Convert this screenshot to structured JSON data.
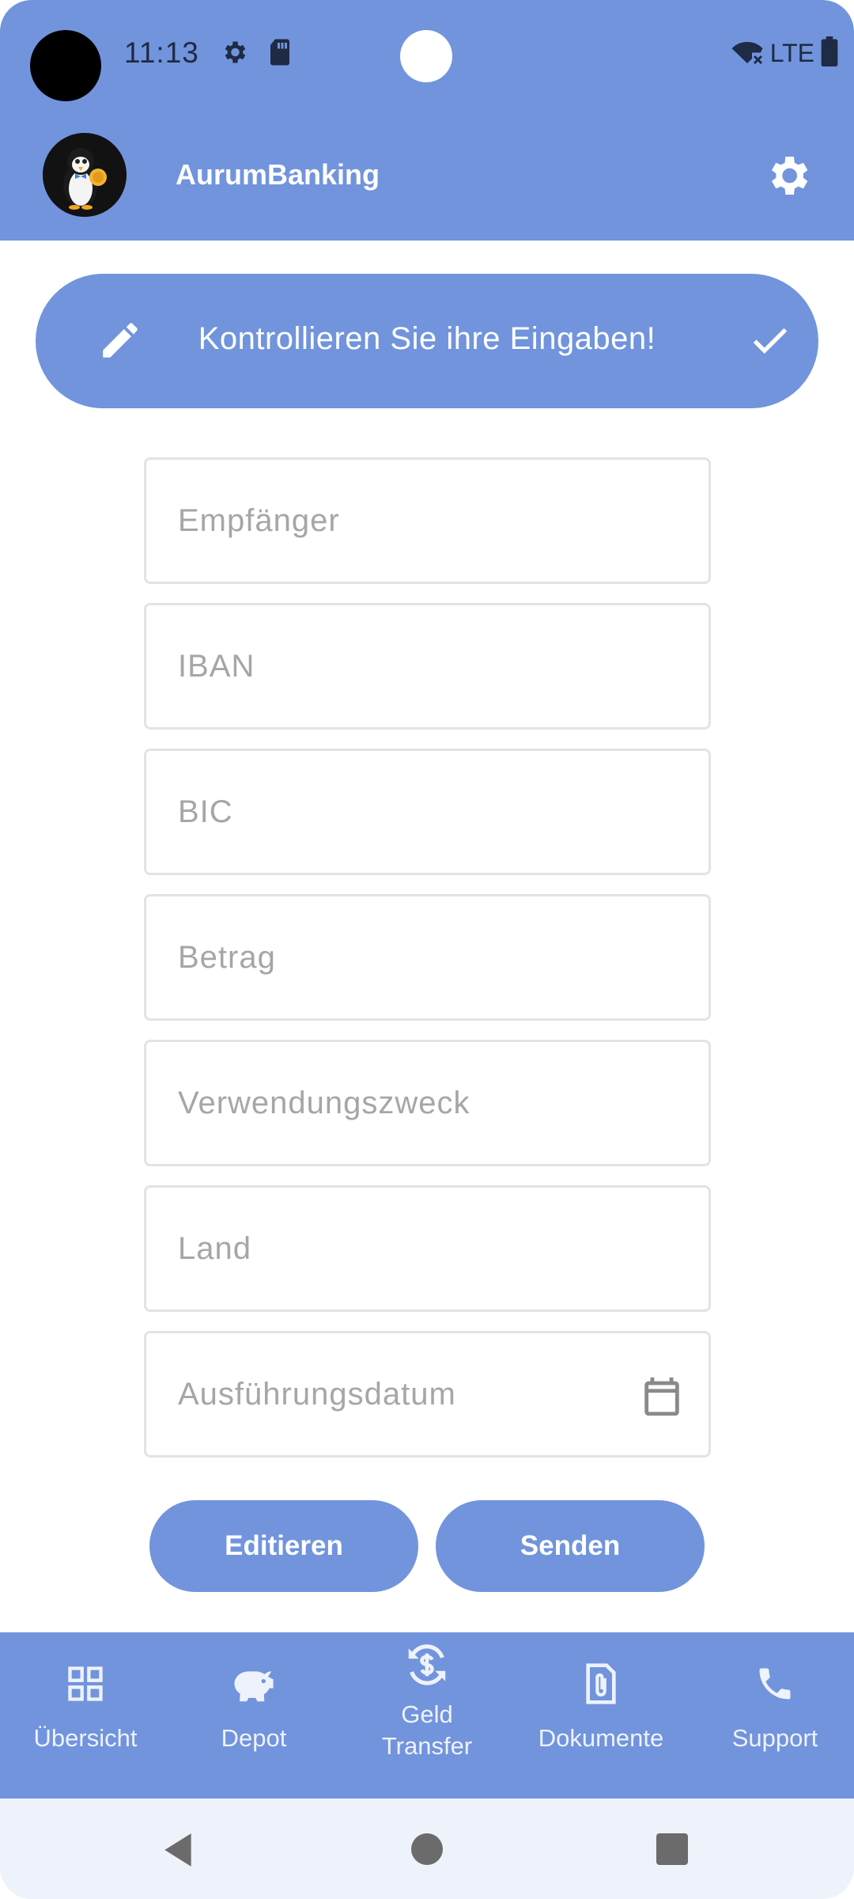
{
  "status_bar": {
    "time": "11:13",
    "network": "LTE",
    "icons": [
      "settings-icon",
      "sd-card-icon",
      "wifi-off-icon",
      "battery-icon"
    ]
  },
  "app_bar": {
    "title": "AurumBanking",
    "avatar": "penguin-mascot-logo",
    "settings_icon": "gear-icon"
  },
  "banner": {
    "message": "Kontrollieren Sie ihre Eingaben!",
    "left_icon": "pencil-icon",
    "right_icon": "check-icon"
  },
  "form": {
    "fields": [
      {
        "name": "recipient",
        "placeholder": "Empfänger",
        "value": ""
      },
      {
        "name": "iban",
        "placeholder": "IBAN",
        "value": ""
      },
      {
        "name": "bic",
        "placeholder": "BIC",
        "value": ""
      },
      {
        "name": "amount",
        "placeholder": "Betrag",
        "value": ""
      },
      {
        "name": "purpose",
        "placeholder": "Verwendungszweck",
        "value": ""
      },
      {
        "name": "country",
        "placeholder": "Land",
        "value": ""
      },
      {
        "name": "execution-date",
        "placeholder": "Ausführungsdatum",
        "value": ""
      }
    ],
    "edit_button": "Editieren",
    "send_button": "Senden"
  },
  "bottom_nav": {
    "items": [
      {
        "label": "Übersicht",
        "icon": "grid-icon"
      },
      {
        "label": "Depot",
        "icon": "piggy-bank-icon"
      },
      {
        "label": "Geld Transfer",
        "icon": "currency-exchange-icon"
      },
      {
        "label": "Dokumente",
        "icon": "document-attachment-icon"
      },
      {
        "label": "Support",
        "icon": "phone-icon"
      }
    ]
  },
  "colors": {
    "accent": "#7194dc",
    "background": "#ffffff",
    "field_border": "#e3e3e3",
    "placeholder": "#a6a6a6",
    "system_nav": "#eef2fa"
  }
}
